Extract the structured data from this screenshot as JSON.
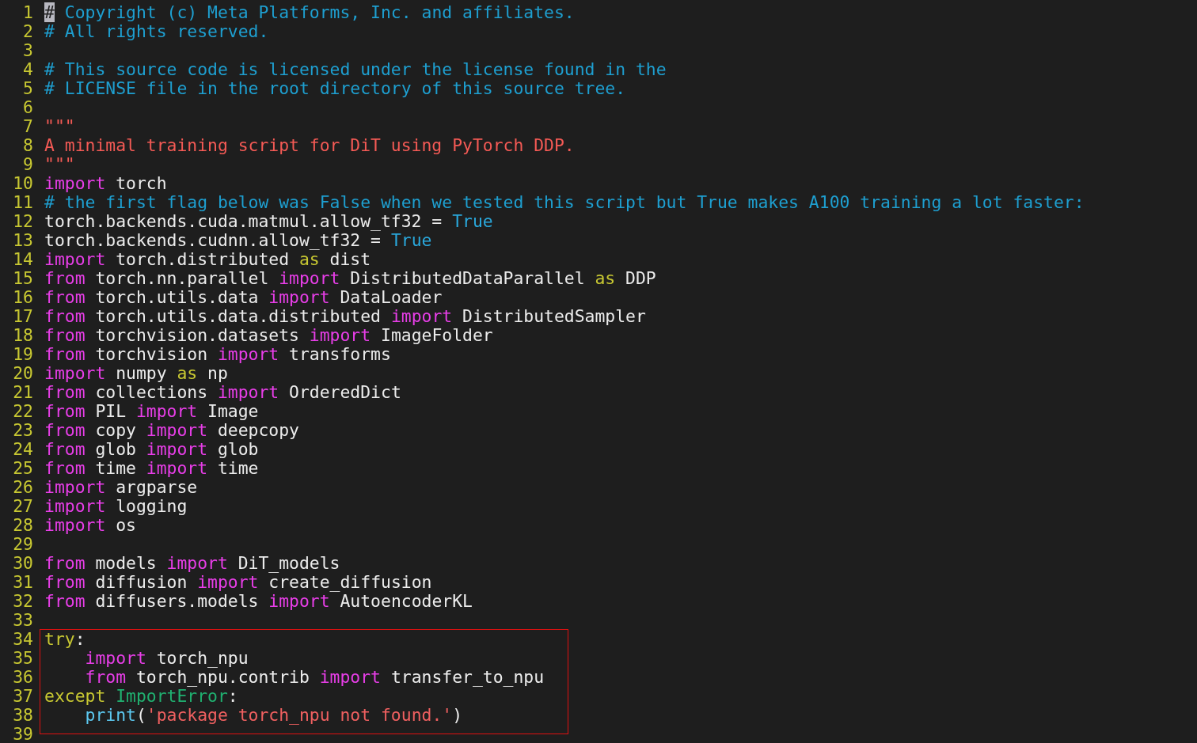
{
  "editor": {
    "lines": [
      {
        "number": "1",
        "boxed": false,
        "tokens": [
          {
            "kind": "cursor",
            "text": "#"
          },
          {
            "kind": "comment",
            "text": " Copyright (c) Meta Platforms, Inc. and affiliates."
          }
        ]
      },
      {
        "number": "2",
        "boxed": false,
        "tokens": [
          {
            "kind": "comment",
            "text": "# All rights reserved."
          }
        ]
      },
      {
        "number": "3",
        "boxed": false
      },
      {
        "number": "4",
        "boxed": false,
        "tokens": [
          {
            "kind": "comment",
            "text": "# This source code is licensed under the license found in the"
          }
        ]
      },
      {
        "number": "5",
        "boxed": false,
        "tokens": [
          {
            "kind": "comment",
            "text": "# LICENSE file in the root directory of this source tree."
          }
        ]
      },
      {
        "number": "6",
        "boxed": false
      },
      {
        "number": "7",
        "boxed": false,
        "tokens": [
          {
            "kind": "docstring",
            "text": "\"\"\""
          }
        ]
      },
      {
        "number": "8",
        "boxed": false,
        "tokens": [
          {
            "kind": "docstring",
            "text": "A minimal training script for DiT using PyTorch DDP."
          }
        ]
      },
      {
        "number": "9",
        "boxed": false,
        "tokens": [
          {
            "kind": "docstring",
            "text": "\"\"\""
          }
        ]
      },
      {
        "number": "10",
        "boxed": false,
        "tokens": [
          {
            "kind": "keyword",
            "text": "import"
          },
          {
            "kind": "plain",
            "text": " torch"
          }
        ]
      },
      {
        "number": "11",
        "boxed": false,
        "tokens": [
          {
            "kind": "comment",
            "text": "# the first flag below was False when we tested this script but True makes A100 training a lot faster:"
          }
        ]
      },
      {
        "number": "12",
        "boxed": false,
        "tokens": [
          {
            "kind": "plain",
            "text": "torch.backends.cuda.matmul.allow_tf32 = "
          },
          {
            "kind": "constant",
            "text": "True"
          }
        ]
      },
      {
        "number": "13",
        "boxed": false,
        "tokens": [
          {
            "kind": "plain",
            "text": "torch.backends.cudnn.allow_tf32 = "
          },
          {
            "kind": "constant",
            "text": "True"
          }
        ]
      },
      {
        "number": "14",
        "boxed": false,
        "tokens": [
          {
            "kind": "keyword",
            "text": "import"
          },
          {
            "kind": "plain",
            "text": " torch.distributed "
          },
          {
            "kind": "control",
            "text": "as"
          },
          {
            "kind": "plain",
            "text": " dist"
          }
        ]
      },
      {
        "number": "15",
        "boxed": false,
        "tokens": [
          {
            "kind": "keyword",
            "text": "from"
          },
          {
            "kind": "plain",
            "text": " torch.nn.parallel "
          },
          {
            "kind": "keyword",
            "text": "import"
          },
          {
            "kind": "plain",
            "text": " DistributedDataParallel "
          },
          {
            "kind": "control",
            "text": "as"
          },
          {
            "kind": "plain",
            "text": " DDP"
          }
        ]
      },
      {
        "number": "16",
        "boxed": false,
        "tokens": [
          {
            "kind": "keyword",
            "text": "from"
          },
          {
            "kind": "plain",
            "text": " torch.utils.data "
          },
          {
            "kind": "keyword",
            "text": "import"
          },
          {
            "kind": "plain",
            "text": " DataLoader"
          }
        ]
      },
      {
        "number": "17",
        "boxed": false,
        "tokens": [
          {
            "kind": "keyword",
            "text": "from"
          },
          {
            "kind": "plain",
            "text": " torch.utils.data.distributed "
          },
          {
            "kind": "keyword",
            "text": "import"
          },
          {
            "kind": "plain",
            "text": " DistributedSampler"
          }
        ]
      },
      {
        "number": "18",
        "boxed": false,
        "tokens": [
          {
            "kind": "keyword",
            "text": "from"
          },
          {
            "kind": "plain",
            "text": " torchvision.datasets "
          },
          {
            "kind": "keyword",
            "text": "import"
          },
          {
            "kind": "plain",
            "text": " ImageFolder"
          }
        ]
      },
      {
        "number": "19",
        "boxed": false,
        "tokens": [
          {
            "kind": "keyword",
            "text": "from"
          },
          {
            "kind": "plain",
            "text": " torchvision "
          },
          {
            "kind": "keyword",
            "text": "import"
          },
          {
            "kind": "plain",
            "text": " transforms"
          }
        ]
      },
      {
        "number": "20",
        "boxed": false,
        "tokens": [
          {
            "kind": "keyword",
            "text": "import"
          },
          {
            "kind": "plain",
            "text": " numpy "
          },
          {
            "kind": "control",
            "text": "as"
          },
          {
            "kind": "plain",
            "text": " np"
          }
        ]
      },
      {
        "number": "21",
        "boxed": false,
        "tokens": [
          {
            "kind": "keyword",
            "text": "from"
          },
          {
            "kind": "plain",
            "text": " collections "
          },
          {
            "kind": "keyword",
            "text": "import"
          },
          {
            "kind": "plain",
            "text": " OrderedDict"
          }
        ]
      },
      {
        "number": "22",
        "boxed": false,
        "tokens": [
          {
            "kind": "keyword",
            "text": "from"
          },
          {
            "kind": "plain",
            "text": " PIL "
          },
          {
            "kind": "keyword",
            "text": "import"
          },
          {
            "kind": "plain",
            "text": " Image"
          }
        ]
      },
      {
        "number": "23",
        "boxed": false,
        "tokens": [
          {
            "kind": "keyword",
            "text": "from"
          },
          {
            "kind": "plain",
            "text": " copy "
          },
          {
            "kind": "keyword",
            "text": "import"
          },
          {
            "kind": "plain",
            "text": " deepcopy"
          }
        ]
      },
      {
        "number": "24",
        "boxed": false,
        "tokens": [
          {
            "kind": "keyword",
            "text": "from"
          },
          {
            "kind": "plain",
            "text": " glob "
          },
          {
            "kind": "keyword",
            "text": "import"
          },
          {
            "kind": "plain",
            "text": " glob"
          }
        ]
      },
      {
        "number": "25",
        "boxed": false,
        "tokens": [
          {
            "kind": "keyword",
            "text": "from"
          },
          {
            "kind": "plain",
            "text": " time "
          },
          {
            "kind": "keyword",
            "text": "import"
          },
          {
            "kind": "plain",
            "text": " time"
          }
        ]
      },
      {
        "number": "26",
        "boxed": false,
        "tokens": [
          {
            "kind": "keyword",
            "text": "import"
          },
          {
            "kind": "plain",
            "text": " argparse"
          }
        ]
      },
      {
        "number": "27",
        "boxed": false,
        "tokens": [
          {
            "kind": "keyword",
            "text": "import"
          },
          {
            "kind": "plain",
            "text": " logging"
          }
        ]
      },
      {
        "number": "28",
        "boxed": false,
        "tokens": [
          {
            "kind": "keyword",
            "text": "import"
          },
          {
            "kind": "plain",
            "text": " os"
          }
        ]
      },
      {
        "number": "29",
        "boxed": false
      },
      {
        "number": "30",
        "boxed": false,
        "tokens": [
          {
            "kind": "keyword",
            "text": "from"
          },
          {
            "kind": "plain",
            "text": " models "
          },
          {
            "kind": "keyword",
            "text": "import"
          },
          {
            "kind": "plain",
            "text": " DiT_models"
          }
        ]
      },
      {
        "number": "31",
        "boxed": false,
        "tokens": [
          {
            "kind": "keyword",
            "text": "from"
          },
          {
            "kind": "plain",
            "text": " diffusion "
          },
          {
            "kind": "keyword",
            "text": "import"
          },
          {
            "kind": "plain",
            "text": " create_diffusion"
          }
        ]
      },
      {
        "number": "32",
        "boxed": false,
        "tokens": [
          {
            "kind": "keyword",
            "text": "from"
          },
          {
            "kind": "plain",
            "text": " diffusers.models "
          },
          {
            "kind": "keyword",
            "text": "import"
          },
          {
            "kind": "plain",
            "text": " AutoencoderKL"
          }
        ]
      },
      {
        "number": "33",
        "boxed": false
      },
      {
        "number": "34",
        "boxed": true,
        "tokens": [
          {
            "kind": "control",
            "text": "try"
          },
          {
            "kind": "plain",
            "text": ":"
          }
        ]
      },
      {
        "number": "35",
        "boxed": true,
        "tokens": [
          {
            "kind": "keyword",
            "text": "    import"
          },
          {
            "kind": "plain",
            "text": " torch_npu"
          }
        ]
      },
      {
        "number": "36",
        "boxed": true,
        "tokens": [
          {
            "kind": "keyword",
            "text": "    from"
          },
          {
            "kind": "plain",
            "text": " torch_npu.contrib "
          },
          {
            "kind": "keyword",
            "text": "import"
          },
          {
            "kind": "plain",
            "text": " transfer_to_npu"
          }
        ]
      },
      {
        "number": "37",
        "boxed": true,
        "tokens": [
          {
            "kind": "control",
            "text": "except"
          },
          {
            "kind": "exception",
            "text": " ImportError"
          },
          {
            "kind": "plain",
            "text": ":"
          }
        ]
      },
      {
        "number": "38",
        "boxed": true,
        "tokens": [
          {
            "kind": "builtin",
            "text": "    print"
          },
          {
            "kind": "plain",
            "text": "("
          },
          {
            "kind": "string",
            "text": "'package torch_npu not found.'"
          },
          {
            "kind": "plain",
            "text": ")"
          }
        ]
      },
      {
        "number": "39",
        "boxed": false
      }
    ]
  }
}
